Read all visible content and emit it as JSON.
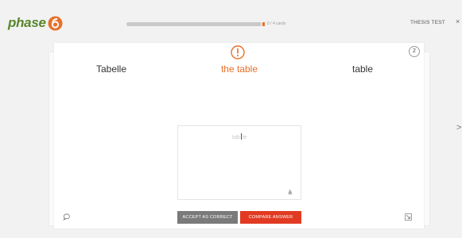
{
  "header": {
    "logo_text": "phase",
    "progress": {
      "fraction": 0.0,
      "label": "0 / 4 cards"
    },
    "project": "THESIS TEST",
    "close": "×"
  },
  "card": {
    "count": "2",
    "source_word": "Tabelle",
    "answer_word": "the table",
    "target_word": "table",
    "input_value": "tab",
    "input_rest": "le",
    "accent_key": "à"
  },
  "buttons": {
    "accept": "ACCEPT AS CORRECT",
    "compare": "COMPARE ANSWER"
  },
  "side_arrow": ">",
  "colors": {
    "brand_green": "#58862a",
    "accent_orange": "#e8702a",
    "compare_red": "#e23a22",
    "accept_gray": "#7a7a7a"
  },
  "icons": [
    "warning-icon",
    "comment-icon",
    "expand-icon",
    "close-icon",
    "next-card-arrow-icon"
  ]
}
